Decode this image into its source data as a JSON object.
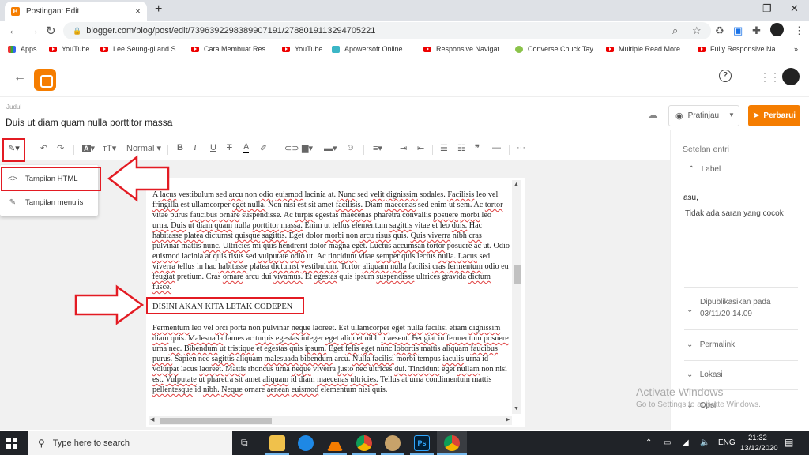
{
  "browser": {
    "tab_title": "Postingan: Edit",
    "tab_close": "×",
    "new_tab": "+",
    "url": "blogger.com/blog/post/edit/7396392298389907191/2788019113294705221",
    "bookmarks": [
      {
        "label": "Apps",
        "icon": "apps-grid-icon"
      },
      {
        "label": "YouTube",
        "icon": "youtube-icon"
      },
      {
        "label": "Lee Seung-gi and S...",
        "icon": "youtube-icon"
      },
      {
        "label": "Cara Membuat Res...",
        "icon": "youtube-icon"
      },
      {
        "label": "YouTube",
        "icon": "youtube-icon"
      },
      {
        "label": "Apowersoft Online...",
        "icon": "apowersoft-icon"
      },
      {
        "label": "Responsive Navigat...",
        "icon": "youtube-icon"
      },
      {
        "label": "Converse Chuck Tay...",
        "icon": "converse-icon"
      },
      {
        "label": "Multiple Read More...",
        "icon": "youtube-icon"
      },
      {
        "label": "Fully Responsive Na...",
        "icon": "youtube-icon"
      }
    ],
    "bookmarks_more": "»"
  },
  "editor": {
    "title_label": "Judul",
    "title_value": "Duis ut diam quam nulla porttitor massa",
    "preview_label": "Pratinjau",
    "update_label": "Perbarui",
    "toolbar": {
      "paragraph_style": "Normal"
    },
    "mode_menu": [
      {
        "label": "Tampilan HTML",
        "icon": "code-icon"
      },
      {
        "label": "Tampilan menulis",
        "icon": "pencil-icon"
      }
    ],
    "paragraph1": "A lacus vestibulum sed arcu non odio euismod lacinia at. Nunc sed velit dignissim sodales. Facilisis leo vel fringilla est ullamcorper eget nulla. Non nisi est sit amet facilisis. Diam maecenas sed enim ut sem. Ac tortor vitae purus faucibus ornare suspendisse. Ac turpis egestas maecenas pharetra convallis posuere morbi leo urna. Duis ut diam quam nulla porttitor massa. Enim ut tellus elementum sagittis vitae et leo duis. Hac habitasse platea dictumst quisque sagittis. Eget dolor morbi non arcu risus quis. Quis viverra nibh cras pulvinar mattis nunc. Ultricies mi quis hendrerit dolor magna eget. Luctus accumsan tortor posuere ac ut. Odio euismod lacinia at quis risus sed vulputate odio ut. Ac tincidunt vitae semper quis lectus nulla. Lacus sed viverra tellus in hac habitasse platea dictumst vestibulum. Tortor aliquam nulla facilisi cras fermentum odio eu feugiat pretium. Cras ornare arcu dui vivamus. Et egestas quis ipsum suspendisse ultrices gravida dictum fusce.",
    "highlight_line": "DISINI AKAN KITA LETAK CODEPEN",
    "paragraph2": "Fermentum leo vel orci porta non pulvinar neque laoreet. Est ullamcorper eget nulla facilisi etiam dignissim diam quis. Malesuada fames ac turpis egestas integer eget aliquet nibh praesent. Feugiat in fermentum posuere urna nec. Bibendum ut tristique et egestas quis ipsum. Eget felis eget nunc lobortis mattis aliquam faucibus purus. Sapien nec sagittis aliquam malesuada bibendum arcu. Nulla facilisi morbi tempus iaculis urna id volutpat lacus laoreet. Mattis rhoncus urna neque viverra justo nec ultrices dui. Tincidunt eget nullam non nisi est. Vulputate ut pharetra sit amet aliquam id diam maecenas ultricies. Tellus at urna condimentum mattis pellentesque id nibh. Neque ornare aenean euismod elementum nisi quis."
  },
  "settings": {
    "heading": "Setelan entri",
    "label_section": "Label",
    "label_value": "asu,",
    "label_suggestion": "Tidak ada saran yang cocok",
    "published_label": "Dipublikasikan pada",
    "published_value": "03/11/20 14.09",
    "permalink": "Permalink",
    "location": "Lokasi",
    "options": "Opsi"
  },
  "watermark": {
    "line1": "Activate Windows",
    "line2": "Go to Settings to activate Windows."
  },
  "taskbar": {
    "search_placeholder": "Type here to search",
    "time": "21:32",
    "date": "13/12/2020",
    "language": "ENG"
  },
  "colors": {
    "accent": "#f57d00",
    "annotation_red": "#e31b23",
    "spellcheck": "#e04040"
  }
}
